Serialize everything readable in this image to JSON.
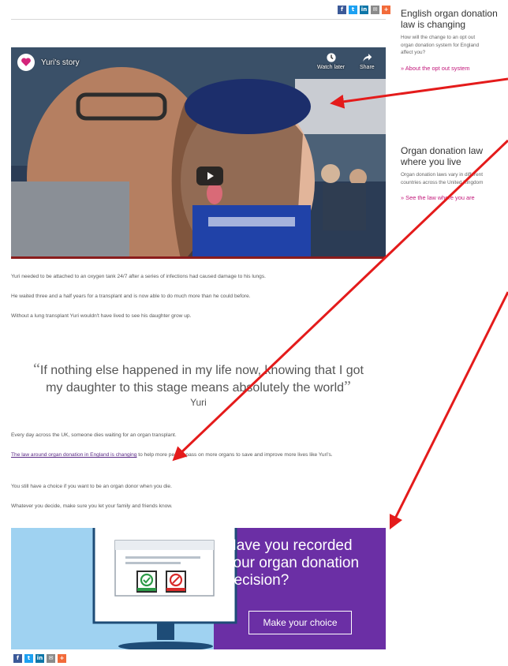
{
  "share_icons": [
    {
      "name": "facebook",
      "glyph": "f",
      "color": "#3b5998"
    },
    {
      "name": "twitter",
      "glyph": "t",
      "color": "#1da1f2"
    },
    {
      "name": "linkedin",
      "glyph": "in",
      "color": "#0e76a8"
    },
    {
      "name": "email",
      "glyph": "✉",
      "color": "#8a8a8a"
    },
    {
      "name": "more",
      "glyph": "+",
      "color": "#f26b3a"
    }
  ],
  "video": {
    "title": "Yuri's story",
    "watch_later": "Watch later",
    "share": "Share"
  },
  "body": {
    "p1": "Yuri needed to be attached to an oxygen tank 24/7 after a series of infections had caused damage to his lungs.",
    "p2": "He waited three and a half years for a transplant and is now able to do much more than he could before.",
    "p3": "Without a lung transplant Yuri wouldn't have lived to see his daughter grow up.",
    "quote_open": "“",
    "quote_line1": "If nothing else happened in my life now, knowing that I got",
    "quote_line2": "my daughter to this stage means absolutely the world",
    "quote_close": "”",
    "quote_author": "Yuri",
    "p4": "Every day across the UK, someone dies waiting for an organ transplant.",
    "p5_link": "The law around organ donation in England is changing",
    "p5_rest": " to help more people pass on more organs to save and improve more lives like Yuri's.",
    "p6": "You still have a choice if you want to be an organ donor when you die.",
    "p7": "Whatever you decide, make sure you let your family and friends know."
  },
  "banner": {
    "heading": "Have you recorded your organ donation decision?",
    "cta": "Make your choice"
  },
  "sidebar": {
    "box1": {
      "title_line1": "English organ donation",
      "title_line2": "law is changing",
      "desc_line1": "How will the change to an opt out",
      "desc_line2": "organ donation system for England",
      "desc_line3": "affect you?",
      "link": "» About the opt out system"
    },
    "box2": {
      "title_line1": "Organ donation law",
      "title_line2": "where you live",
      "desc_line1": "Organ donation laws vary in different",
      "desc_line2": "countries across the United Kingdom",
      "link": "» See the law where you are"
    }
  },
  "colors": {
    "purple": "#6b2fa5",
    "sidebar_link": "#c2177a",
    "arrow": "#e41b1b",
    "banner_sky": "#9fd2f1"
  }
}
